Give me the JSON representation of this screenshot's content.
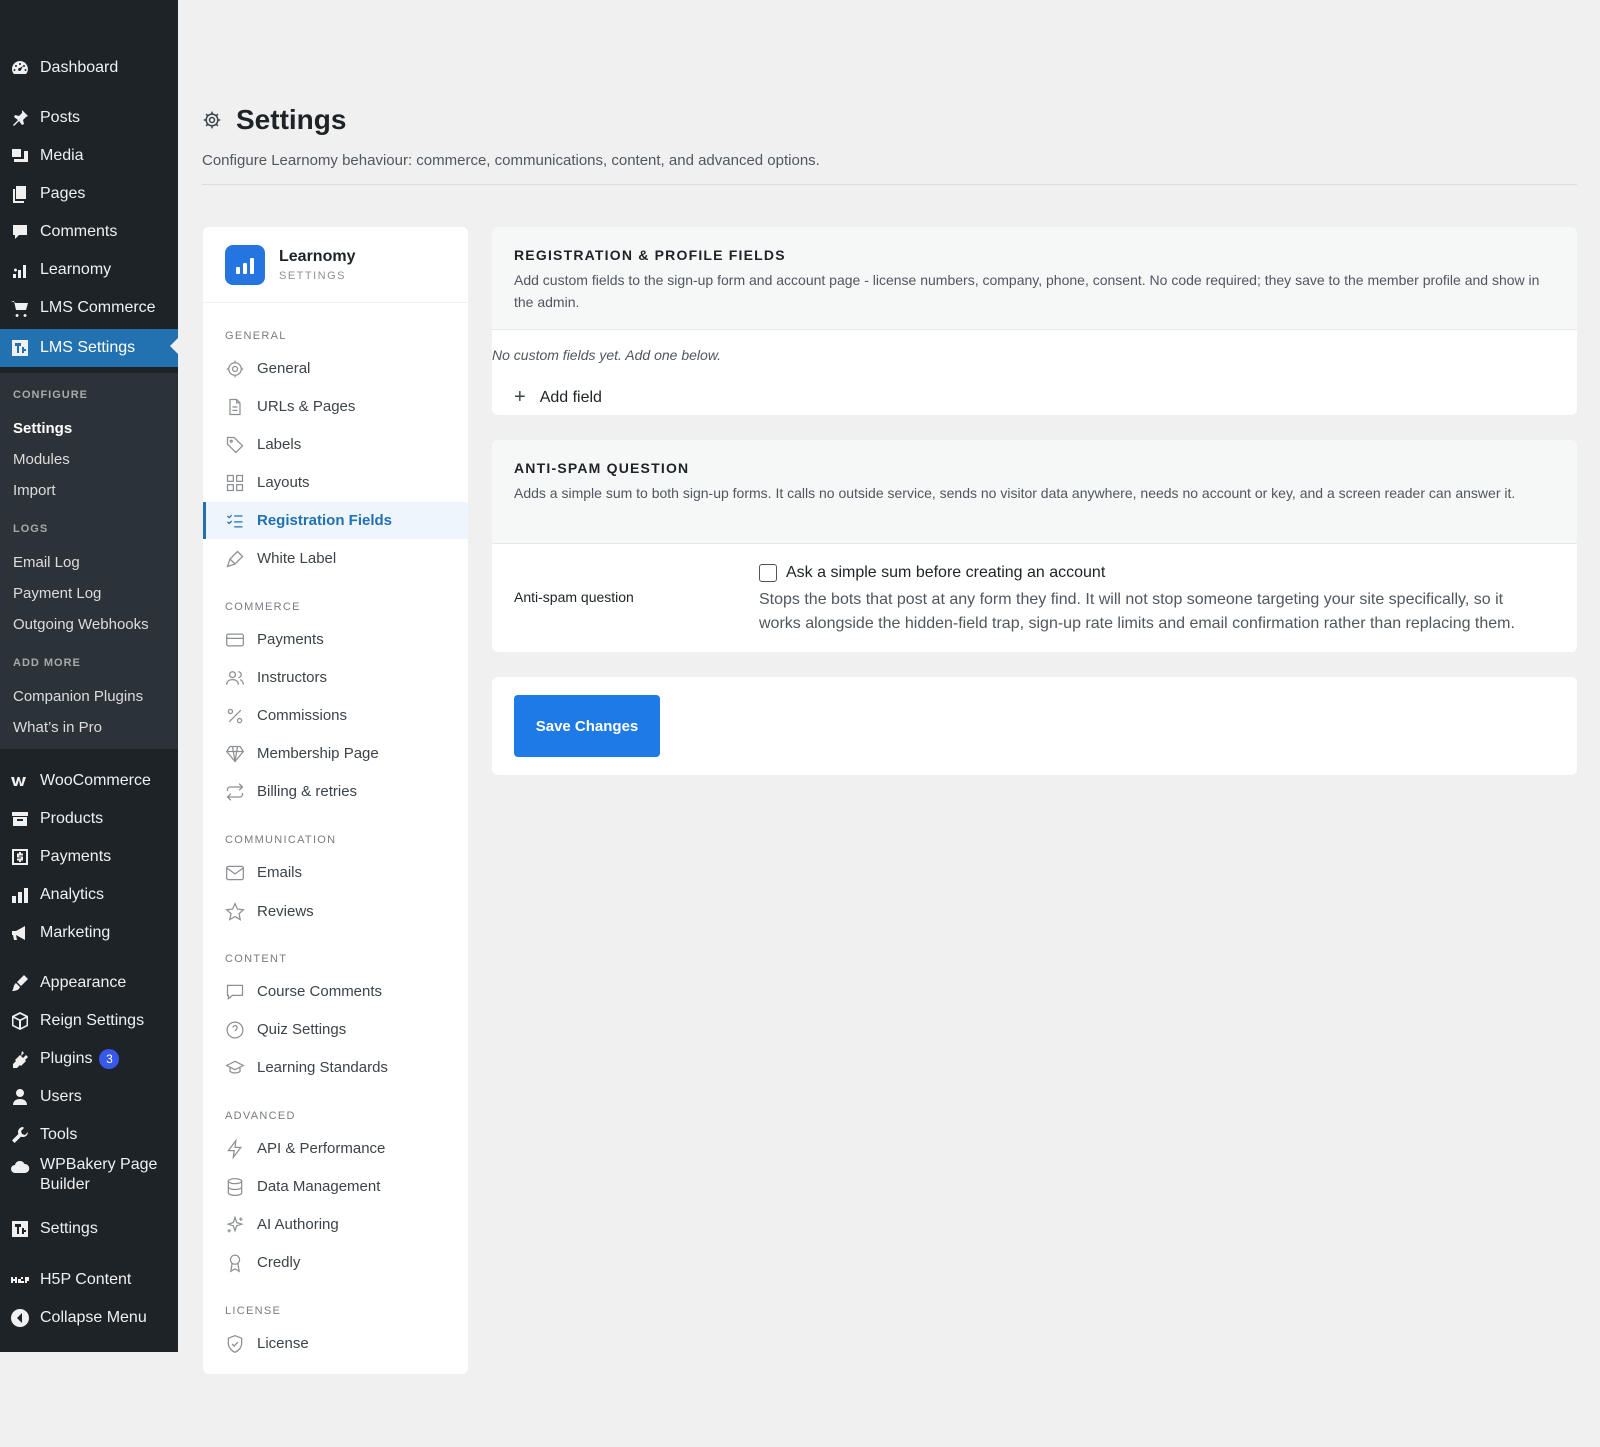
{
  "wp_menu": {
    "items": [
      {
        "label": "Dashboard",
        "icon": "dashboard-icon"
      },
      {
        "label": "Posts",
        "icon": "pin-icon"
      },
      {
        "label": "Media",
        "icon": "media-icon"
      },
      {
        "label": "Pages",
        "icon": "pages-icon"
      },
      {
        "label": "Comments",
        "icon": "comment-icon"
      },
      {
        "label": "Learnomy",
        "icon": "bars-icon"
      },
      {
        "label": "LMS Commerce",
        "icon": "cart-icon"
      },
      {
        "label": "LMS Settings",
        "icon": "settings-box-icon"
      }
    ],
    "submenu": {
      "configure_heading": "CONFIGURE",
      "configure": [
        "Settings",
        "Modules",
        "Import"
      ],
      "logs_heading": "LOGS",
      "logs": [
        "Email Log",
        "Payment Log",
        "Outgoing Webhooks"
      ],
      "addmore_heading": "ADD MORE",
      "addmore": [
        "Companion Plugins",
        "What’s in Pro"
      ]
    },
    "items2": [
      {
        "label": "WooCommerce",
        "icon": "woo-icon"
      },
      {
        "label": "Products",
        "icon": "archive-icon"
      },
      {
        "label": "Payments",
        "icon": "dollar-icon"
      },
      {
        "label": "Analytics",
        "icon": "chart-icon"
      },
      {
        "label": "Marketing",
        "icon": "megaphone-icon"
      },
      {
        "label": "Appearance",
        "icon": "brush-icon"
      },
      {
        "label": "Reign Settings",
        "icon": "cube-icon"
      },
      {
        "label": "Plugins",
        "icon": "plug-icon",
        "badge": "3"
      },
      {
        "label": "Users",
        "icon": "user-icon"
      },
      {
        "label": "Tools",
        "icon": "wrench-icon"
      },
      {
        "label": "WPBakery Page",
        "label2": "Builder",
        "icon": "cloud-icon"
      },
      {
        "label": "Settings",
        "icon": "settings-box-icon"
      },
      {
        "label": "H5P Content",
        "icon": "h5p-icon"
      },
      {
        "label": "Collapse Menu",
        "icon": "collapse-icon"
      }
    ]
  },
  "page": {
    "title": "Settings",
    "description": "Configure Learnomy behaviour: commerce, communications, content, and advanced options."
  },
  "nav": {
    "brand_name": "Learnomy",
    "brand_sub": "SETTINGS",
    "general_heading": "GENERAL",
    "general": [
      "General",
      "URLs & Pages",
      "Labels",
      "Layouts",
      "Registration Fields",
      "White Label"
    ],
    "commerce_heading": "COMMERCE",
    "commerce": [
      "Payments",
      "Instructors",
      "Commissions",
      "Membership Page",
      "Billing & retries"
    ],
    "communication_heading": "COMMUNICATION",
    "communication": [
      "Emails",
      "Reviews"
    ],
    "content_heading": "CONTENT",
    "content": [
      "Course Comments",
      "Quiz Settings",
      "Learning Standards"
    ],
    "advanced_heading": "ADVANCED",
    "advanced": [
      "API & Performance",
      "Data Management",
      "AI Authoring",
      "Credly"
    ],
    "license_heading": "LICENSE",
    "license": [
      "License"
    ]
  },
  "registration": {
    "title": "REGISTRATION & PROFILE FIELDS",
    "description": "Add custom fields to the sign-up form and account page - license numbers, company, phone, consent. No code required; they save to the member profile and show in the admin.",
    "empty_note": "No custom fields yet. Add one below.",
    "add_label": "Add field"
  },
  "antispam": {
    "title": "ANTI-SPAM QUESTION",
    "description": "Adds a simple sum to both sign-up forms. It calls no outside service, sends no visitor data anywhere, needs no account or key, and a screen reader can answer it.",
    "field_label": "Anti-spam question",
    "checkbox_label": "Ask a simple sum before creating an account",
    "checked": false,
    "help": "Stops the bots that post at any form they find. It will not stop someone targeting your site specifically, so it works alongside the hidden-field trap, sign-up rate limits and email confirmation rather than replacing them."
  },
  "actions": {
    "save_label": "Save Changes"
  },
  "colors": {
    "accent": "#2271b1",
    "button": "#1e7ae6",
    "sidebar": "#1d2327"
  }
}
